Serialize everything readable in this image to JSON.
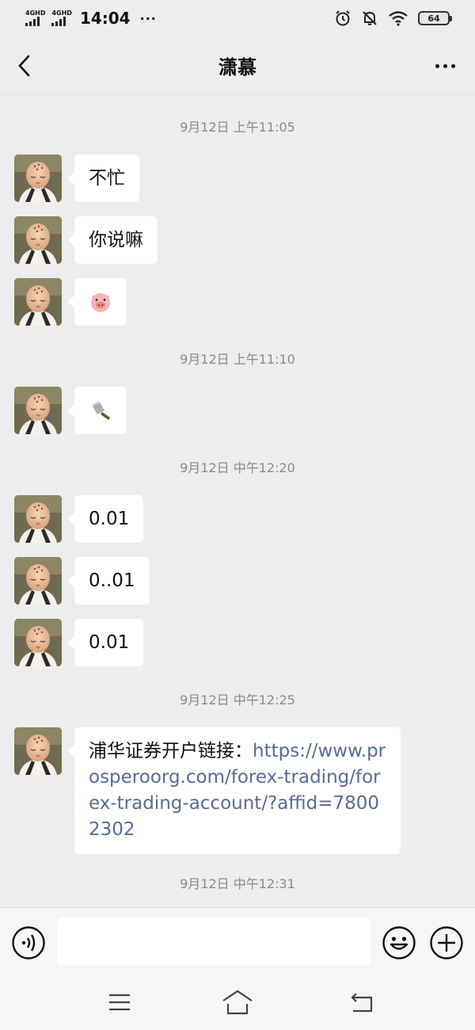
{
  "status_bar": {
    "network_1": "4GHD",
    "network_2": "4GHD",
    "time": "14:04",
    "overflow": "···",
    "battery": "64",
    "icons": [
      "alarm-icon",
      "mute-bell-icon",
      "wifi-icon",
      "battery-icon"
    ]
  },
  "header": {
    "title": "潇慕",
    "back_icon": "chevron-left-icon",
    "more_icon": "more-dots-icon"
  },
  "messages": [
    {
      "type": "timestamp",
      "text": "9月12日 上午11:05"
    },
    {
      "type": "text",
      "text": "不忙"
    },
    {
      "type": "text",
      "text": "你说嘛"
    },
    {
      "type": "emoji",
      "icon": "pig-face-icon"
    },
    {
      "type": "timestamp",
      "text": "9月12日 上午11:10"
    },
    {
      "type": "emoji",
      "icon": "cleaver-knife-icon"
    },
    {
      "type": "timestamp",
      "text": "9月12日 中午12:20"
    },
    {
      "type": "text",
      "text": "0.01"
    },
    {
      "type": "text",
      "text": "0..01"
    },
    {
      "type": "text",
      "text": "0.01"
    },
    {
      "type": "timestamp",
      "text": "9月12日 中午12:25"
    },
    {
      "type": "link",
      "prefix": "浦华证券开户链接：",
      "url": "https://www.prosperoorg.com/forex-trading/forex-trading-account/?affid=78002302"
    },
    {
      "type": "timestamp",
      "text": "9月12日 中午12:31"
    }
  ],
  "input_bar": {
    "voice_icon": "voice-icon",
    "input_value": "",
    "emoji_icon": "smiley-icon",
    "plus_icon": "plus-circle-icon"
  },
  "nav_bar": {
    "icons": [
      "menu-icon",
      "home-icon",
      "back-arrow-icon"
    ]
  },
  "colors": {
    "background": "#ededed",
    "bubble": "#ffffff",
    "link": "#576b95",
    "timestamp": "#8a8a8a"
  }
}
